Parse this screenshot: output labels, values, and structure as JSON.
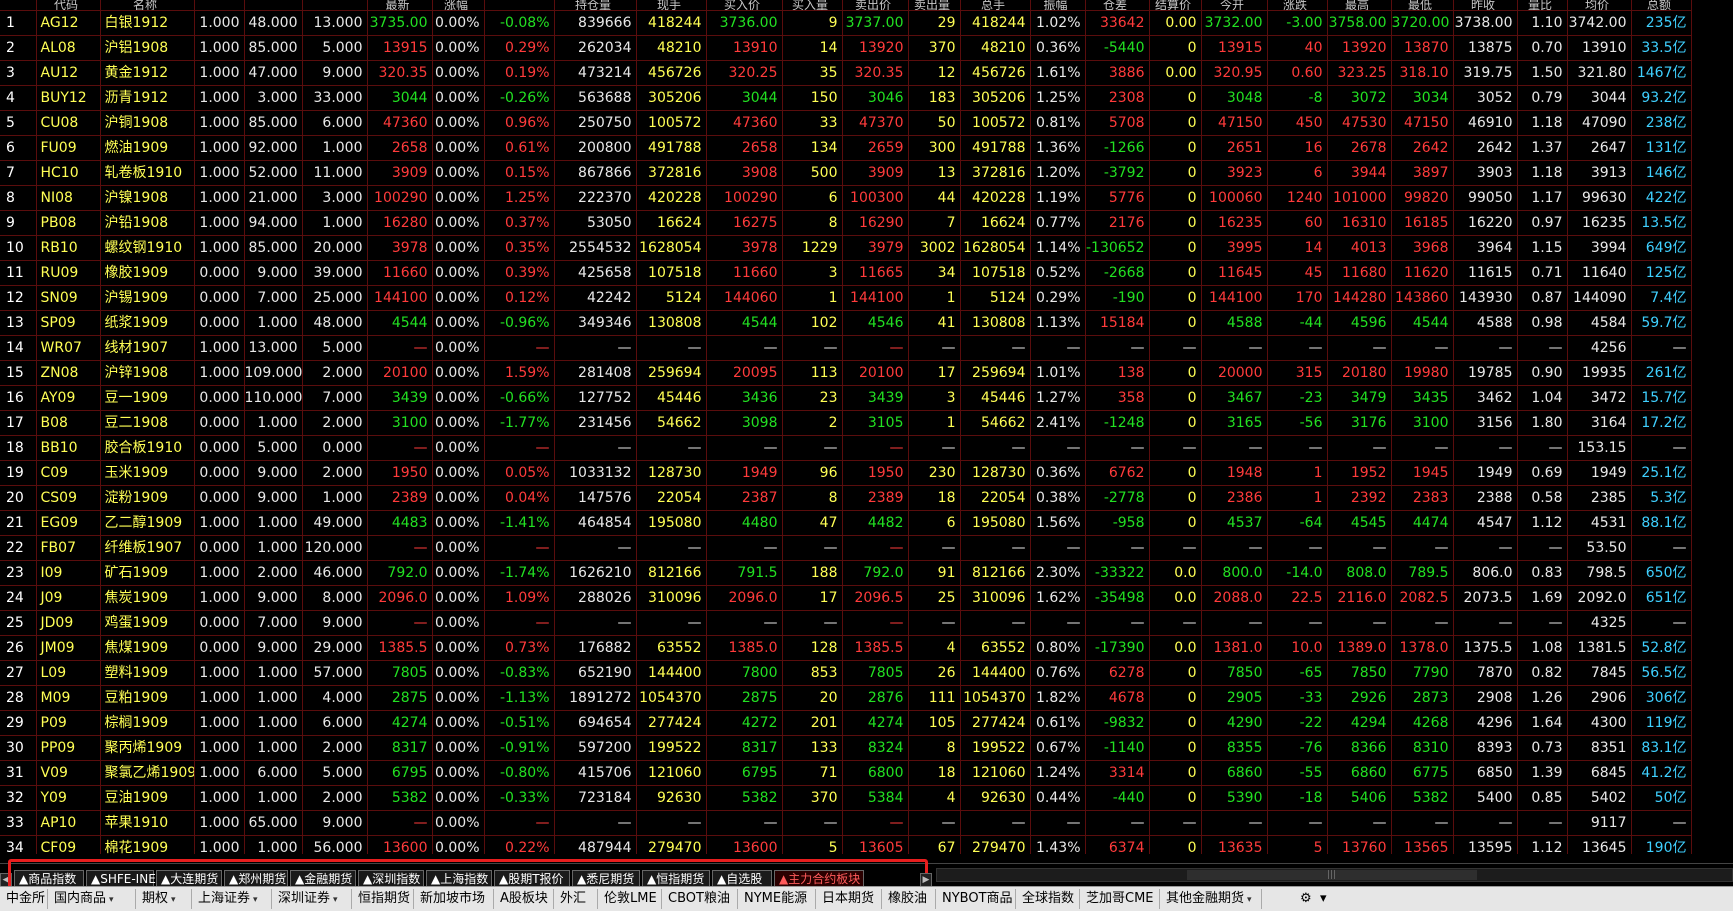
{
  "columns": [
    "代码",
    "名称",
    "",
    "",
    "",
    "最新",
    "涨幅",
    "",
    "持仓量",
    "现手",
    "买入价",
    "买入量",
    "卖出价",
    "卖出量",
    "总手",
    "振幅",
    "仓差",
    "结算价",
    "今开",
    "涨跌",
    "最高",
    "最低",
    "昨收",
    "量比",
    "均价",
    "总额"
  ],
  "rows": [
    [
      "1",
      "AG12",
      "白银1912",
      "1.000",
      "48.000",
      "13.000",
      "3735.00",
      "0.00%",
      "-0.08%",
      "839666",
      "418244",
      "3736.00",
      "9",
      "3737.00",
      "29",
      "418244",
      "1.02%",
      "33642",
      "0.00",
      "3732.00",
      "-3.00",
      "3758.00",
      "3720.00",
      "3738.00",
      "1.10",
      "3742.00",
      "235亿"
    ],
    [
      "2",
      "AL08",
      "沪铝1908",
      "1.000",
      "85.000",
      "5.000",
      "13915",
      "0.00%",
      "0.29%",
      "262034",
      "48210",
      "13910",
      "14",
      "13920",
      "370",
      "48210",
      "0.36%",
      "-5440",
      "0",
      "13915",
      "40",
      "13920",
      "13870",
      "13875",
      "0.70",
      "13910",
      "33.5亿"
    ],
    [
      "3",
      "AU12",
      "黄金1912",
      "1.000",
      "47.000",
      "9.000",
      "320.35",
      "0.00%",
      "0.19%",
      "473214",
      "456726",
      "320.25",
      "35",
      "320.35",
      "12",
      "456726",
      "1.61%",
      "3886",
      "0.00",
      "320.95",
      "0.60",
      "323.25",
      "318.10",
      "319.75",
      "1.50",
      "321.80",
      "1467亿"
    ],
    [
      "4",
      "BUY12",
      "沥青1912",
      "1.000",
      "3.000",
      "33.000",
      "3044",
      "0.00%",
      "-0.26%",
      "563688",
      "305206",
      "3044",
      "150",
      "3046",
      "183",
      "305206",
      "1.25%",
      "2308",
      "0",
      "3048",
      "-8",
      "3072",
      "3034",
      "3052",
      "0.79",
      "3044",
      "93.2亿"
    ],
    [
      "5",
      "CU08",
      "沪铜1908",
      "1.000",
      "85.000",
      "6.000",
      "47360",
      "0.00%",
      "0.96%",
      "250750",
      "100572",
      "47360",
      "33",
      "47370",
      "50",
      "100572",
      "0.81%",
      "5708",
      "0",
      "47150",
      "450",
      "47530",
      "47150",
      "46910",
      "1.18",
      "47090",
      "238亿"
    ],
    [
      "6",
      "FU09",
      "燃油1909",
      "1.000",
      "92.000",
      "1.000",
      "2658",
      "0.00%",
      "0.61%",
      "200800",
      "491788",
      "2658",
      "134",
      "2659",
      "300",
      "491788",
      "1.36%",
      "-1266",
      "0",
      "2651",
      "16",
      "2678",
      "2642",
      "2642",
      "1.37",
      "2647",
      "131亿"
    ],
    [
      "7",
      "HC10",
      "轧卷板1910",
      "1.000",
      "52.000",
      "11.000",
      "3909",
      "0.00%",
      "0.15%",
      "867866",
      "372816",
      "3908",
      "500",
      "3909",
      "13",
      "372816",
      "1.20%",
      "-3792",
      "0",
      "3923",
      "6",
      "3944",
      "3897",
      "3903",
      "1.18",
      "3913",
      "146亿"
    ],
    [
      "8",
      "NI08",
      "沪镍1908",
      "1.000",
      "21.000",
      "3.000",
      "100290",
      "0.00%",
      "1.25%",
      "222370",
      "420228",
      "100290",
      "6",
      "100300",
      "44",
      "420228",
      "1.19%",
      "5776",
      "0",
      "100060",
      "1240",
      "101000",
      "99820",
      "99050",
      "1.17",
      "99630",
      "422亿"
    ],
    [
      "9",
      "PB08",
      "沪铅1908",
      "1.000",
      "94.000",
      "1.000",
      "16280",
      "0.00%",
      "0.37%",
      "53050",
      "16624",
      "16275",
      "8",
      "16290",
      "7",
      "16624",
      "0.77%",
      "2176",
      "0",
      "16235",
      "60",
      "16310",
      "16185",
      "16220",
      "0.97",
      "16235",
      "13.5亿"
    ],
    [
      "10",
      "RB10",
      "螺纹钢1910",
      "1.000",
      "85.000",
      "20.000",
      "3978",
      "0.00%",
      "0.35%",
      "2554532",
      "1628054",
      "3978",
      "1229",
      "3979",
      "3002",
      "1628054",
      "1.14%",
      "-130652",
      "0",
      "3995",
      "14",
      "4013",
      "3968",
      "3964",
      "1.15",
      "3994",
      "649亿"
    ],
    [
      "11",
      "RU09",
      "橡胶1909",
      "0.000",
      "9.000",
      "39.000",
      "11660",
      "0.00%",
      "0.39%",
      "425658",
      "107518",
      "11660",
      "3",
      "11665",
      "34",
      "107518",
      "0.52%",
      "-2668",
      "0",
      "11645",
      "45",
      "11680",
      "11620",
      "11615",
      "0.71",
      "11640",
      "125亿"
    ],
    [
      "12",
      "SN09",
      "沪锡1909",
      "0.000",
      "7.000",
      "25.000",
      "144100",
      "0.00%",
      "0.12%",
      "42242",
      "5124",
      "144060",
      "1",
      "144100",
      "1",
      "5124",
      "0.29%",
      "-190",
      "0",
      "144100",
      "170",
      "144280",
      "143860",
      "143930",
      "0.87",
      "144090",
      "7.4亿"
    ],
    [
      "13",
      "SP09",
      "纸浆1909",
      "0.000",
      "1.000",
      "48.000",
      "4544",
      "0.00%",
      "-0.96%",
      "349346",
      "130808",
      "4544",
      "102",
      "4546",
      "41",
      "130808",
      "1.13%",
      "15184",
      "0",
      "4588",
      "-44",
      "4596",
      "4544",
      "4588",
      "0.98",
      "4584",
      "59.7亿"
    ],
    [
      "14",
      "WR07",
      "线材1907",
      "1.000",
      "13.000",
      "5.000",
      "—",
      "0.00%",
      "—",
      "—",
      "—",
      "—",
      "—",
      "—",
      "—",
      "—",
      "—",
      "—",
      "—",
      "—",
      "—",
      "—",
      "—",
      "—",
      "—",
      "4256",
      "—"
    ],
    [
      "15",
      "ZN08",
      "沪锌1908",
      "1.000",
      "109.000",
      "2.000",
      "20100",
      "0.00%",
      "1.59%",
      "281408",
      "259694",
      "20095",
      "113",
      "20100",
      "17",
      "259694",
      "1.01%",
      "138",
      "0",
      "20000",
      "315",
      "20180",
      "19980",
      "19785",
      "0.90",
      "19935",
      "261亿"
    ],
    [
      "16",
      "AY09",
      "豆一1909",
      "0.000",
      "110.000",
      "7.000",
      "3439",
      "0.00%",
      "-0.66%",
      "127752",
      "45446",
      "3436",
      "23",
      "3439",
      "3",
      "45446",
      "1.27%",
      "358",
      "0",
      "3467",
      "-23",
      "3479",
      "3435",
      "3462",
      "1.04",
      "3472",
      "15.7亿"
    ],
    [
      "17",
      "B08",
      "豆二1908",
      "0.000",
      "1.000",
      "2.000",
      "3100",
      "0.00%",
      "-1.77%",
      "231456",
      "54662",
      "3098",
      "2",
      "3105",
      "1",
      "54662",
      "2.41%",
      "-1248",
      "0",
      "3165",
      "-56",
      "3176",
      "3100",
      "3156",
      "1.80",
      "3164",
      "17.2亿"
    ],
    [
      "18",
      "BB10",
      "胶合板1910",
      "0.000",
      "5.000",
      "0.000",
      "—",
      "0.00%",
      "—",
      "—",
      "—",
      "—",
      "—",
      "—",
      "—",
      "—",
      "—",
      "—",
      "—",
      "—",
      "—",
      "—",
      "—",
      "—",
      "—",
      "153.15",
      "—"
    ],
    [
      "19",
      "C09",
      "玉米1909",
      "0.000",
      "9.000",
      "2.000",
      "1950",
      "0.00%",
      "0.05%",
      "1033132",
      "128730",
      "1949",
      "96",
      "1950",
      "230",
      "128730",
      "0.36%",
      "6762",
      "0",
      "1948",
      "1",
      "1952",
      "1945",
      "1949",
      "0.69",
      "1949",
      "25.1亿"
    ],
    [
      "20",
      "CS09",
      "淀粉1909",
      "0.000",
      "9.000",
      "1.000",
      "2389",
      "0.00%",
      "0.04%",
      "147576",
      "22054",
      "2387",
      "8",
      "2389",
      "18",
      "22054",
      "0.38%",
      "-2778",
      "0",
      "2386",
      "1",
      "2392",
      "2383",
      "2388",
      "0.58",
      "2385",
      "5.3亿"
    ],
    [
      "21",
      "EG09",
      "乙二醇1909",
      "1.000",
      "1.000",
      "49.000",
      "4483",
      "0.00%",
      "-1.41%",
      "464854",
      "195080",
      "4480",
      "47",
      "4482",
      "6",
      "195080",
      "1.56%",
      "-958",
      "0",
      "4537",
      "-64",
      "4545",
      "4474",
      "4547",
      "1.12",
      "4531",
      "88.1亿"
    ],
    [
      "22",
      "FB07",
      "纤维板1907",
      "0.000",
      "1.000",
      "120.000",
      "—",
      "0.00%",
      "—",
      "—",
      "—",
      "—",
      "—",
      "—",
      "—",
      "—",
      "—",
      "—",
      "—",
      "—",
      "—",
      "—",
      "—",
      "—",
      "—",
      "53.50",
      "—"
    ],
    [
      "23",
      "I09",
      "矿石1909",
      "1.000",
      "2.000",
      "46.000",
      "792.0",
      "0.00%",
      "-1.74%",
      "1626210",
      "812166",
      "791.5",
      "188",
      "792.0",
      "91",
      "812166",
      "2.30%",
      "-33322",
      "0.0",
      "800.0",
      "-14.0",
      "808.0",
      "789.5",
      "806.0",
      "0.83",
      "798.5",
      "650亿"
    ],
    [
      "24",
      "J09",
      "焦炭1909",
      "1.000",
      "9.000",
      "8.000",
      "2096.0",
      "0.00%",
      "1.09%",
      "288026",
      "310096",
      "2096.0",
      "17",
      "2096.5",
      "25",
      "310096",
      "1.62%",
      "-35498",
      "0.0",
      "2088.0",
      "22.5",
      "2116.0",
      "2082.5",
      "2073.5",
      "1.69",
      "2092.0",
      "651亿"
    ],
    [
      "25",
      "JD09",
      "鸡蛋1909",
      "0.000",
      "7.000",
      "9.000",
      "—",
      "0.00%",
      "—",
      "—",
      "—",
      "—",
      "—",
      "—",
      "—",
      "—",
      "—",
      "—",
      "—",
      "—",
      "—",
      "—",
      "—",
      "—",
      "—",
      "4325",
      "—"
    ],
    [
      "26",
      "JM09",
      "焦煤1909",
      "0.000",
      "9.000",
      "29.000",
      "1385.5",
      "0.00%",
      "0.73%",
      "176882",
      "63552",
      "1385.0",
      "128",
      "1385.5",
      "4",
      "63552",
      "0.80%",
      "-17390",
      "0.0",
      "1381.0",
      "10.0",
      "1389.0",
      "1378.0",
      "1375.5",
      "1.08",
      "1381.5",
      "52.8亿"
    ],
    [
      "27",
      "L09",
      "塑料1909",
      "1.000",
      "1.000",
      "57.000",
      "7805",
      "0.00%",
      "-0.83%",
      "652190",
      "144400",
      "7800",
      "853",
      "7805",
      "26",
      "144400",
      "0.76%",
      "6278",
      "0",
      "7850",
      "-65",
      "7850",
      "7790",
      "7870",
      "0.82",
      "7845",
      "56.5亿"
    ],
    [
      "28",
      "M09",
      "豆粕1909",
      "1.000",
      "1.000",
      "4.000",
      "2875",
      "0.00%",
      "-1.13%",
      "1891272",
      "1054370",
      "2875",
      "20",
      "2876",
      "111",
      "1054370",
      "1.82%",
      "4678",
      "0",
      "2905",
      "-33",
      "2926",
      "2873",
      "2908",
      "1.26",
      "2906",
      "306亿"
    ],
    [
      "29",
      "P09",
      "棕榈1909",
      "1.000",
      "1.000",
      "6.000",
      "4274",
      "0.00%",
      "-0.51%",
      "694654",
      "277424",
      "4272",
      "201",
      "4274",
      "105",
      "277424",
      "0.61%",
      "-9832",
      "0",
      "4290",
      "-22",
      "4294",
      "4268",
      "4296",
      "1.64",
      "4300",
      "119亿"
    ],
    [
      "30",
      "PP09",
      "聚丙烯1909",
      "1.000",
      "1.000",
      "2.000",
      "8317",
      "0.00%",
      "-0.91%",
      "597200",
      "199522",
      "8317",
      "133",
      "8324",
      "8",
      "199522",
      "0.67%",
      "-1140",
      "0",
      "8355",
      "-76",
      "8366",
      "8310",
      "8393",
      "0.73",
      "8351",
      "83.1亿"
    ],
    [
      "31",
      "V09",
      "聚氯乙烯1909",
      "1.000",
      "6.000",
      "5.000",
      "6795",
      "0.00%",
      "-0.80%",
      "415706",
      "121060",
      "6795",
      "71",
      "6800",
      "18",
      "121060",
      "1.24%",
      "3314",
      "0",
      "6860",
      "-55",
      "6860",
      "6775",
      "6850",
      "1.39",
      "6845",
      "41.2亿"
    ],
    [
      "32",
      "Y09",
      "豆油1909",
      "1.000",
      "1.000",
      "2.000",
      "5382",
      "0.00%",
      "-0.33%",
      "723184",
      "92630",
      "5382",
      "370",
      "5384",
      "4",
      "92630",
      "0.44%",
      "-440",
      "0",
      "5390",
      "-18",
      "5406",
      "5382",
      "5400",
      "0.85",
      "5402",
      "50亿"
    ],
    [
      "33",
      "AP10",
      "苹果1910",
      "1.000",
      "65.000",
      "9.000",
      "—",
      "0.00%",
      "—",
      "—",
      "—",
      "—",
      "—",
      "—",
      "—",
      "—",
      "—",
      "—",
      "—",
      "—",
      "—",
      "—",
      "—",
      "—",
      "—",
      "9117",
      "—"
    ],
    [
      "34",
      "CF09",
      "棉花1909",
      "1.000",
      "1.000",
      "56.000",
      "13600",
      "0.00%",
      "0.22%",
      "487944",
      "279470",
      "13600",
      "5",
      "13605",
      "67",
      "279470",
      "1.43%",
      "6374",
      "0",
      "13635",
      "5",
      "13760",
      "13565",
      "13595",
      "1.12",
      "13645",
      "190亿"
    ]
  ],
  "sheet_tabs": [
    "▲商品指数",
    "▲SHFE-INE",
    "▲大连期货",
    "▲郑州期货",
    "▲金融期货",
    "▲深圳指数",
    "▲上海指数",
    "▲股期T报价",
    "▲悉尼期货",
    "▲恒指期货",
    "▲自选股",
    "▲主力合约板块"
  ],
  "active_sheet_tab": 11,
  "bottom_tabs": [
    {
      "label": "中金所",
      "caret": false
    },
    {
      "label": "国内商品",
      "caret": true
    },
    {
      "label": "期权",
      "caret": true
    },
    {
      "label": "上海证券",
      "caret": true
    },
    {
      "label": "深圳证券",
      "caret": true
    },
    {
      "label": "恒指期货",
      "caret": false
    },
    {
      "label": "新加坡市场",
      "caret": false
    },
    {
      "label": "A股板块",
      "caret": false
    },
    {
      "label": "外汇",
      "caret": false
    },
    {
      "label": "伦敦LME",
      "caret": false
    },
    {
      "label": "CBOT粮油",
      "caret": false
    },
    {
      "label": "NYME能源",
      "caret": false
    },
    {
      "label": "日本期货",
      "caret": false
    },
    {
      "label": "橡胶油",
      "caret": false
    },
    {
      "label": "NYBOT商品",
      "caret": false
    },
    {
      "label": "全球指数",
      "caret": false
    },
    {
      "label": "芝加哥CME",
      "caret": false
    },
    {
      "label": "其他金融期货",
      "caret": true
    }
  ],
  "colors": {
    "up": "#ff3b3b",
    "down": "#22e022",
    "neutral": "#e8e8e8",
    "label": "#ffff55",
    "amount": "#3fd0ff",
    "highlight_border": "#e81e1e"
  }
}
